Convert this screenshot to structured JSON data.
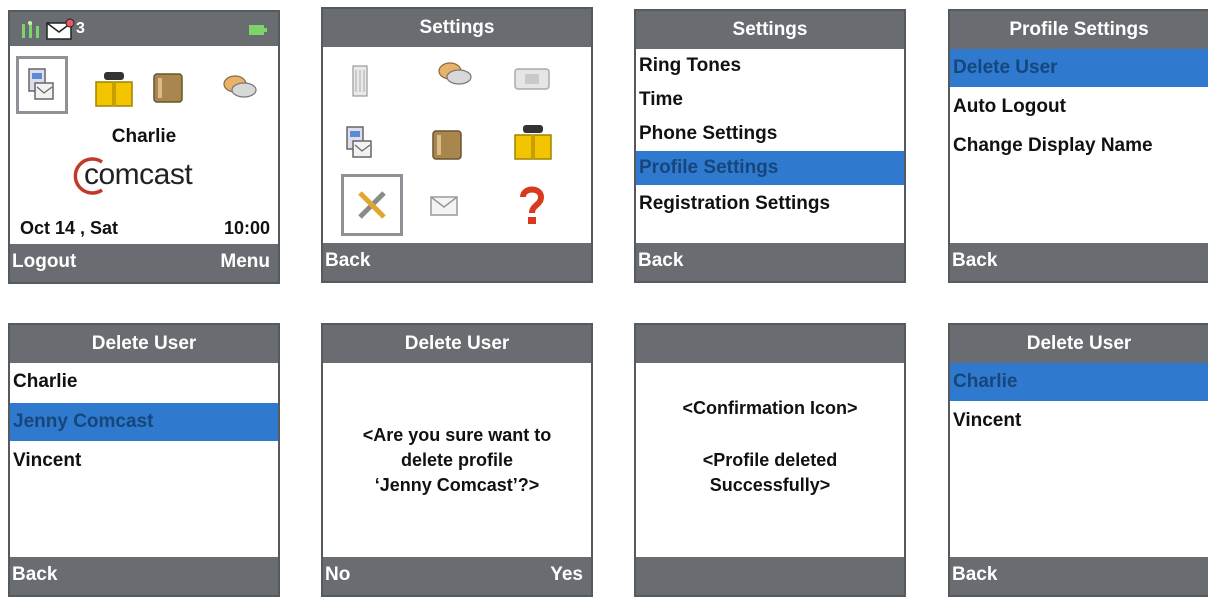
{
  "home": {
    "notification_count": "3",
    "user_name": "Charlie",
    "brand": "comcast",
    "date": "Oct 14 , Sat",
    "time": "10:00",
    "left_softkey": "Logout",
    "right_softkey": "Menu",
    "icons": [
      "signal-icon",
      "mail-icon",
      "battery-icon",
      "contacts-card-icon",
      "phone-book-icon",
      "notebook-icon",
      "chat-bubbles-icon"
    ]
  },
  "settings_grid": {
    "title": "Settings",
    "left_softkey": "Back",
    "icons": [
      "phone-list-icon",
      "chat-bubbles-icon",
      "screen-icon",
      "contacts-card-icon",
      "notebook-icon",
      "phone-book-icon",
      "tools-icon",
      "envelope-icon",
      "help-question-icon"
    ]
  },
  "settings_list": {
    "title": "Settings",
    "items": [
      "Ring Tones",
      "Time",
      "Phone Settings",
      "Profile Settings",
      "Registration Settings"
    ],
    "selected_index": 3,
    "left_softkey": "Back"
  },
  "profile_settings": {
    "title": "Profile Settings",
    "items": [
      "Delete User",
      "Auto Logout",
      "Change Display Name"
    ],
    "selected_index": 0,
    "left_softkey": "Back"
  },
  "delete_user": {
    "title": "Delete User",
    "items": [
      "Charlie",
      "Jenny Comcast",
      "Vincent"
    ],
    "selected_index": 1,
    "left_softkey": "Back"
  },
  "delete_confirm": {
    "title": "Delete User",
    "message_lines": [
      "<Are you sure want to",
      "delete profile",
      "‘Jenny Comcast’?>"
    ],
    "left_softkey": "No",
    "right_softkey": "Yes"
  },
  "deleted_notice": {
    "title": "",
    "icon_line": "<Confirmation Icon>",
    "message_lines": [
      "<Profile deleted",
      "Successfully>"
    ]
  },
  "delete_user_after": {
    "title": "Delete User",
    "items": [
      "Charlie",
      "Vincent"
    ],
    "selected_index": 0,
    "left_softkey": "Back"
  },
  "colors": {
    "bar": "#696c70",
    "selection": "#2f79cf",
    "selection_text": "#17467a",
    "brand_red": "#c0392b"
  }
}
